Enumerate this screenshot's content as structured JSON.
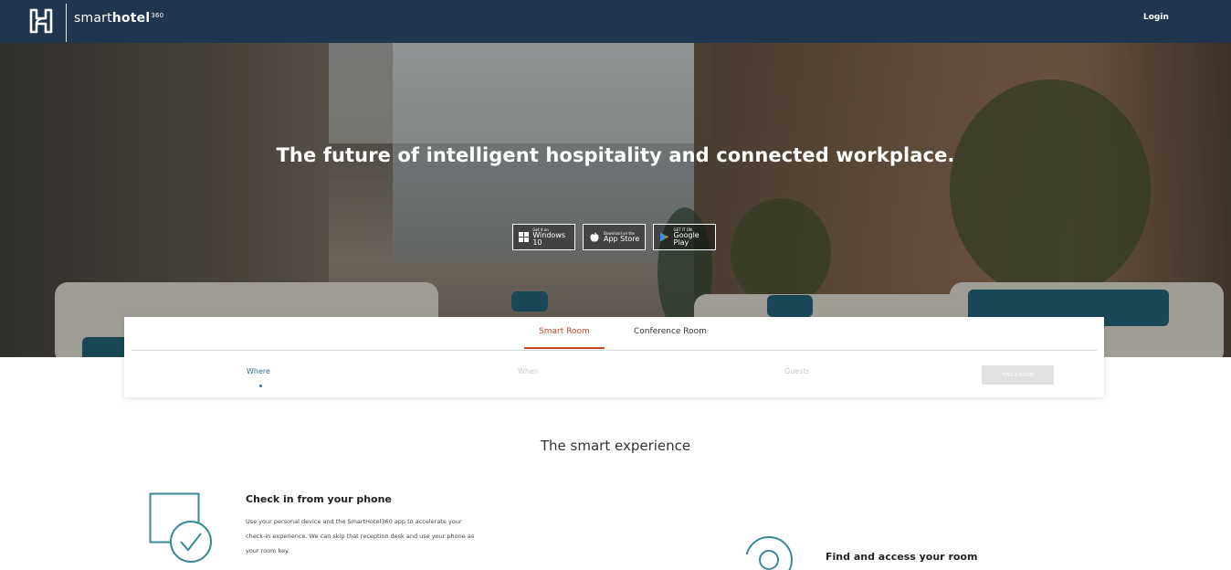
{
  "header": {
    "brand_prefix": "smart",
    "brand_strong": "hotel",
    "brand_sup": "360",
    "login_label": "Login"
  },
  "hero": {
    "title": "The future of intelligent hospitality and connected workplace.",
    "stores": [
      {
        "small": "Get it on",
        "big": "Windows 10",
        "icon": "windows-icon"
      },
      {
        "small": "Download on the",
        "big": "App Store",
        "icon": "apple-icon"
      },
      {
        "small": "GET IT ON",
        "big": "Google Play",
        "icon": "google-play-icon"
      }
    ]
  },
  "search": {
    "tabs": [
      "Smart Room",
      "Conference Room"
    ],
    "active_tab": "Smart Room",
    "fields": {
      "where": "Where",
      "when": "When",
      "guests": "Guests"
    },
    "find_label": "FIND A ROOM"
  },
  "experience": {
    "title": "The smart experience",
    "features": [
      {
        "title": "Check in from your phone",
        "desc_lines": [
          "Use your personal device and the SmartHotel360 app to accelerate your",
          "check-in experience. We can skip that reception desk and use your phone as",
          "your room key."
        ],
        "icon": "phone-checkin-icon"
      },
      {
        "title": "Find and access your room",
        "icon": "room-access-icon"
      }
    ]
  },
  "colors": {
    "header_bg": "#1e3650",
    "accent": "#c5492c",
    "teal": "#3a8a93",
    "where_color": "#3a6f84"
  }
}
